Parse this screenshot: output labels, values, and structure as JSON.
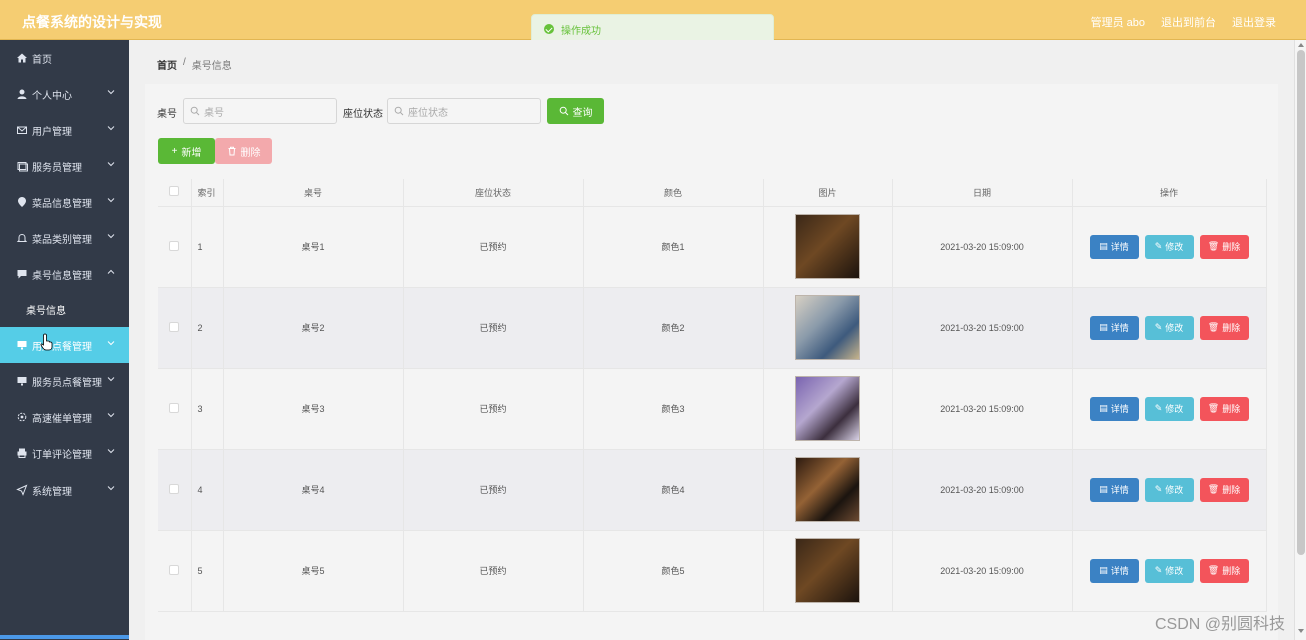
{
  "header": {
    "app_title": "点餐系统的设计与实现",
    "user_label": "管理员 abo",
    "back_home": "退出到前台",
    "logout": "退出登录"
  },
  "toast": {
    "text": "操作成功"
  },
  "sidebar": {
    "items": [
      {
        "label": "首页",
        "icon": "home-icon"
      },
      {
        "label": "个人中心",
        "icon": "user-icon"
      },
      {
        "label": "用户管理",
        "icon": "mail-icon"
      },
      {
        "label": "服务员管理",
        "icon": "card-icon"
      },
      {
        "label": "菜品信息管理",
        "icon": "tag-icon"
      },
      {
        "label": "菜品类别管理",
        "icon": "bell-icon"
      },
      {
        "label": "桌号信息管理",
        "icon": "chat-icon"
      },
      {
        "label": "桌号信息",
        "sub": true
      },
      {
        "label": "用户点餐管理",
        "icon": "monitor-icon",
        "active": true
      },
      {
        "label": "服务员点餐管理",
        "icon": "monitor-icon"
      },
      {
        "label": "高速催单管理",
        "icon": "gear-icon"
      },
      {
        "label": "订单评论管理",
        "icon": "printer-icon"
      },
      {
        "label": "系统管理",
        "icon": "send-icon"
      }
    ]
  },
  "breadcrumb": {
    "home": "首页",
    "current": "桌号信息"
  },
  "search": {
    "table_no_label": "桌号",
    "table_no_placeholder": "桌号",
    "status_label": "座位状态",
    "status_placeholder": "座位状态",
    "search_button": "查询"
  },
  "actions": {
    "add": "新增",
    "delete": "删除"
  },
  "table": {
    "columns": [
      "索引",
      "桌号",
      "座位状态",
      "颜色",
      "图片",
      "日期",
      "操作"
    ],
    "rows": [
      {
        "index": "1",
        "table_no": "桌号1",
        "status": "已预约",
        "color": "颜色1",
        "date": "2021-03-20 15:09:00"
      },
      {
        "index": "2",
        "table_no": "桌号2",
        "status": "已预约",
        "color": "颜色2",
        "date": "2021-03-20 15:09:00"
      },
      {
        "index": "3",
        "table_no": "桌号3",
        "status": "已预约",
        "color": "颜色3",
        "date": "2021-03-20 15:09:00"
      },
      {
        "index": "4",
        "table_no": "桌号4",
        "status": "已预约",
        "color": "颜色4",
        "date": "2021-03-20 15:09:00"
      },
      {
        "index": "5",
        "table_no": "桌号5",
        "status": "已预约",
        "color": "颜色5",
        "date": "2021-03-20 15:09:00"
      }
    ],
    "row_buttons": {
      "detail": "详情",
      "edit": "修改",
      "delete": "删除"
    }
  },
  "watermark": "CSDN @别圆科技",
  "colors": {
    "header": "#f5cd72",
    "sidebar": "#323a48",
    "active": "#55cde7",
    "success": "#5ab836",
    "danger": "#f3545b",
    "primary": "#3b82c4",
    "info": "#57bfd7"
  }
}
